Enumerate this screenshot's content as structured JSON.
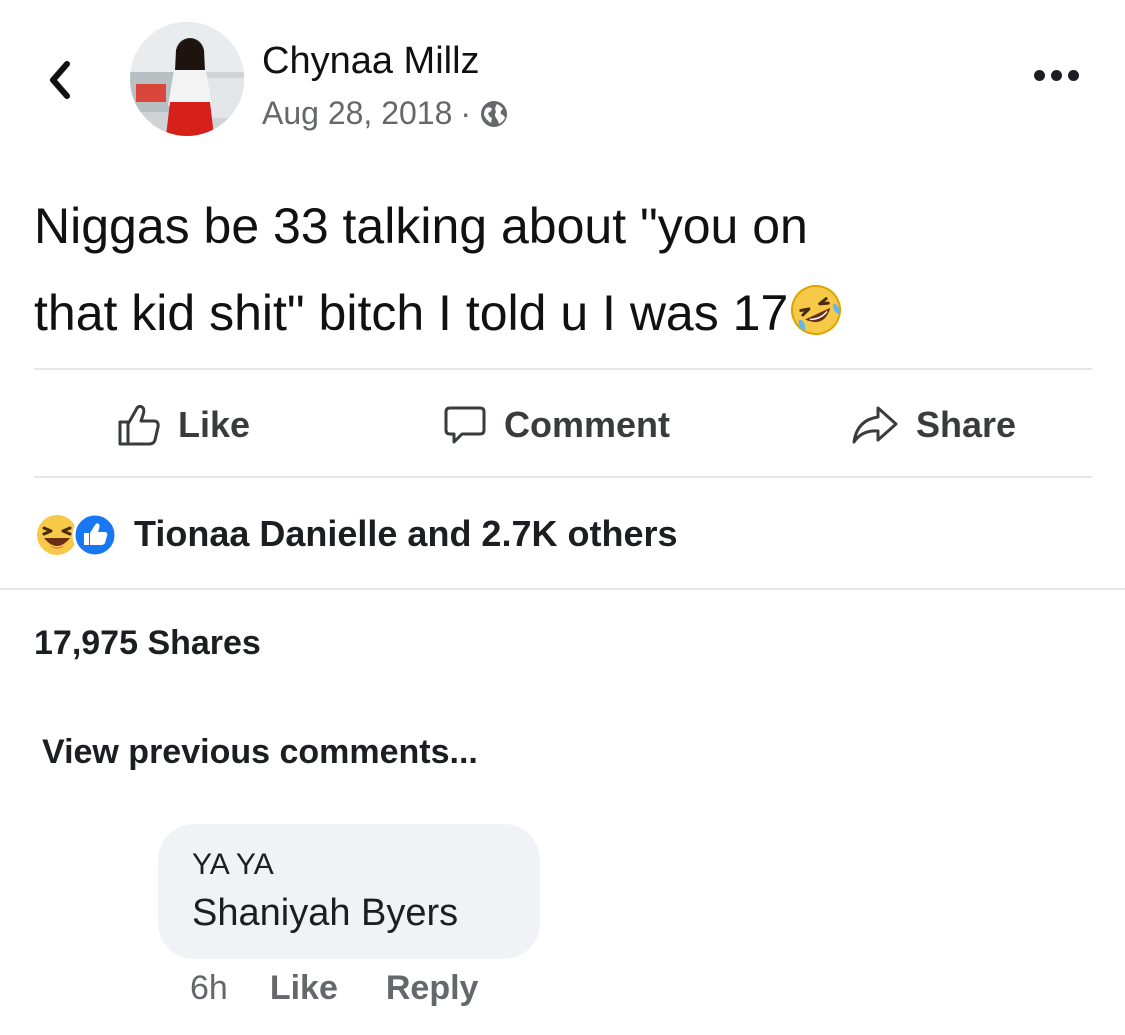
{
  "header": {
    "author_name": "Chynaa Millz",
    "post_date": "Aug 28, 2018",
    "separator": "·",
    "privacy_icon": "globe-icon",
    "back_icon": "chevron-left-icon",
    "more_icon": "more-dots-icon"
  },
  "post": {
    "line1": "Niggas be 33 talking about \"you on",
    "line2": "that kid shit\"  bitch I told u I was 17",
    "trailing_emoji": "rolling-on-floor-laughing-emoji"
  },
  "actions": {
    "like_label": "Like",
    "comment_label": "Comment",
    "share_label": "Share"
  },
  "reactions": {
    "icons": [
      "laughing-reaction-icon",
      "like-reaction-icon"
    ],
    "summary": "Tionaa Danielle and 2.7K others"
  },
  "shares": {
    "count_text": "17,975 Shares"
  },
  "comments": {
    "view_previous": "View previous comments...",
    "items": [
      {
        "author": "YA YA",
        "text": "Shaniyah Byers",
        "time": "6h",
        "like_label": "Like",
        "reply_label": "Reply"
      }
    ]
  },
  "colors": {
    "primary_text": "#1c1e21",
    "secondary_text": "#65676b",
    "divider": "#e4e6eb",
    "bubble_bg": "#f0f2f5",
    "like_blue": "#1877f2",
    "emoji_yellow": "#f7c948"
  }
}
